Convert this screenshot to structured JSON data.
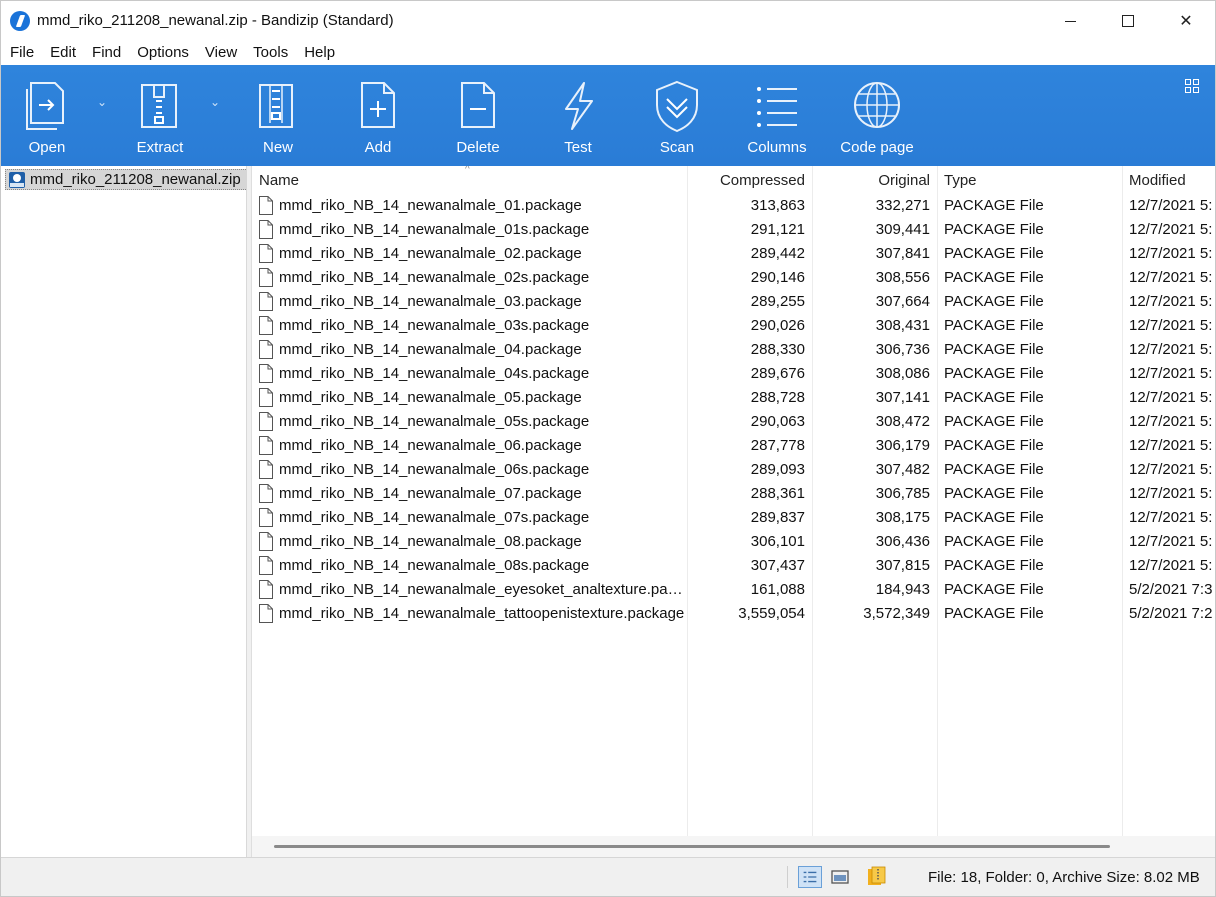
{
  "window": {
    "title": "mmd_riko_211208_newanal.zip - Bandizip (Standard)",
    "close_glyph": "✕"
  },
  "menu": [
    "File",
    "Edit",
    "Find",
    "Options",
    "View",
    "Tools",
    "Help"
  ],
  "toolbar": {
    "buttons": [
      {
        "label": "Open",
        "icon": "open-archive-icon"
      },
      {
        "label": "Extract",
        "icon": "extract-icon"
      },
      {
        "label": "New",
        "icon": "new-archive-icon"
      },
      {
        "label": "Add",
        "icon": "add-file-icon"
      },
      {
        "label": "Delete",
        "icon": "delete-file-icon"
      },
      {
        "label": "Test",
        "icon": "test-lightning-icon"
      },
      {
        "label": "Scan",
        "icon": "scan-shield-icon"
      },
      {
        "label": "Columns",
        "icon": "columns-icon"
      },
      {
        "label": "Code page",
        "icon": "code-page-globe-icon"
      }
    ],
    "dropdown_glyph": "⌄"
  },
  "tree": {
    "root": "mmd_riko_211208_newanal.zip"
  },
  "columns": {
    "name": "Name",
    "compressed": "Compressed",
    "original": "Original",
    "type": "Type",
    "modified": "Modified",
    "sort_glyph": "^"
  },
  "files": [
    {
      "name": "mmd_riko_NB_14_newanalmale_01.package",
      "compressed": "313,863",
      "original": "332,271",
      "type": "PACKAGE File",
      "modified": "12/7/2021 5:"
    },
    {
      "name": "mmd_riko_NB_14_newanalmale_01s.package",
      "compressed": "291,121",
      "original": "309,441",
      "type": "PACKAGE File",
      "modified": "12/7/2021 5:"
    },
    {
      "name": "mmd_riko_NB_14_newanalmale_02.package",
      "compressed": "289,442",
      "original": "307,841",
      "type": "PACKAGE File",
      "modified": "12/7/2021 5:"
    },
    {
      "name": "mmd_riko_NB_14_newanalmale_02s.package",
      "compressed": "290,146",
      "original": "308,556",
      "type": "PACKAGE File",
      "modified": "12/7/2021 5:"
    },
    {
      "name": "mmd_riko_NB_14_newanalmale_03.package",
      "compressed": "289,255",
      "original": "307,664",
      "type": "PACKAGE File",
      "modified": "12/7/2021 5:"
    },
    {
      "name": "mmd_riko_NB_14_newanalmale_03s.package",
      "compressed": "290,026",
      "original": "308,431",
      "type": "PACKAGE File",
      "modified": "12/7/2021 5:"
    },
    {
      "name": "mmd_riko_NB_14_newanalmale_04.package",
      "compressed": "288,330",
      "original": "306,736",
      "type": "PACKAGE File",
      "modified": "12/7/2021 5:"
    },
    {
      "name": "mmd_riko_NB_14_newanalmale_04s.package",
      "compressed": "289,676",
      "original": "308,086",
      "type": "PACKAGE File",
      "modified": "12/7/2021 5:"
    },
    {
      "name": "mmd_riko_NB_14_newanalmale_05.package",
      "compressed": "288,728",
      "original": "307,141",
      "type": "PACKAGE File",
      "modified": "12/7/2021 5:"
    },
    {
      "name": "mmd_riko_NB_14_newanalmale_05s.package",
      "compressed": "290,063",
      "original": "308,472",
      "type": "PACKAGE File",
      "modified": "12/7/2021 5:"
    },
    {
      "name": "mmd_riko_NB_14_newanalmale_06.package",
      "compressed": "287,778",
      "original": "306,179",
      "type": "PACKAGE File",
      "modified": "12/7/2021 5:"
    },
    {
      "name": "mmd_riko_NB_14_newanalmale_06s.package",
      "compressed": "289,093",
      "original": "307,482",
      "type": "PACKAGE File",
      "modified": "12/7/2021 5:"
    },
    {
      "name": "mmd_riko_NB_14_newanalmale_07.package",
      "compressed": "288,361",
      "original": "306,785",
      "type": "PACKAGE File",
      "modified": "12/7/2021 5:"
    },
    {
      "name": "mmd_riko_NB_14_newanalmale_07s.package",
      "compressed": "289,837",
      "original": "308,175",
      "type": "PACKAGE File",
      "modified": "12/7/2021 5:"
    },
    {
      "name": "mmd_riko_NB_14_newanalmale_08.package",
      "compressed": "306,101",
      "original": "306,436",
      "type": "PACKAGE File",
      "modified": "12/7/2021 5:"
    },
    {
      "name": "mmd_riko_NB_14_newanalmale_08s.package",
      "compressed": "307,437",
      "original": "307,815",
      "type": "PACKAGE File",
      "modified": "12/7/2021 5:"
    },
    {
      "name": "mmd_riko_NB_14_newanalmale_eyesoket_analtexture.packa…",
      "compressed": "161,088",
      "original": "184,943",
      "type": "PACKAGE File",
      "modified": "5/2/2021 7:3"
    },
    {
      "name": "mmd_riko_NB_14_newanalmale_tattoopenistexture.package",
      "compressed": "3,559,054",
      "original": "3,572,349",
      "type": "PACKAGE File",
      "modified": "5/2/2021 7:2"
    }
  ],
  "status": {
    "summary": "File: 18, Folder: 0, Archive Size: 8.02 MB"
  },
  "colors": {
    "toolbar_blue": "#2a7cd6",
    "selection_gray": "#d6d6d6"
  }
}
